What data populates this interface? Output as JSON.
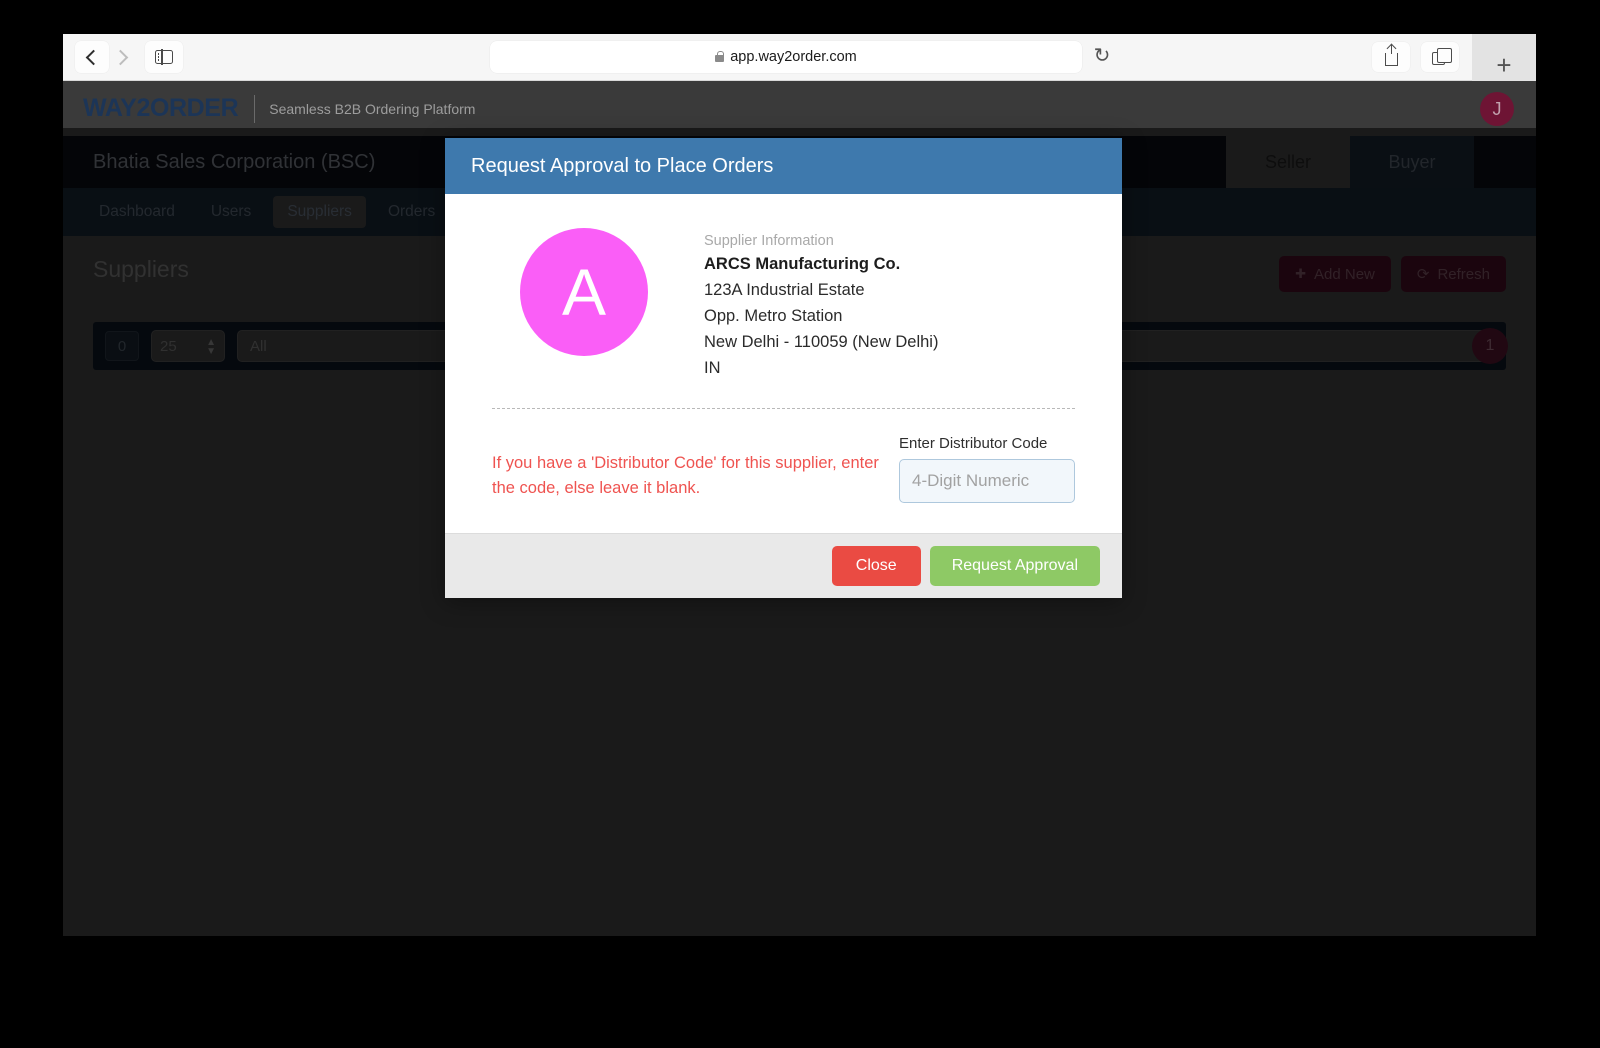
{
  "browser": {
    "url": "app.way2order.com",
    "back_icon": "chevron-left-icon",
    "forward_icon": "chevron-right-icon",
    "sidebar_icon": "sidebar-toggle-icon",
    "lock_icon": "lock-icon",
    "reload_icon": "↻",
    "share_icon": "share-icon",
    "tabs_icon": "tabs-overview-icon",
    "new_tab_label": "+"
  },
  "app_header": {
    "brand": "WAY2ORDER",
    "tagline": "Seamless B2B Ordering Platform",
    "avatar_initial": "J",
    "brand_color": "#1c3557",
    "avatar_color": "#6e1434"
  },
  "org_bar": {
    "org_name": "Bhatia Sales Corporation (BSC)",
    "role_tabs": [
      {
        "label": "Seller",
        "active": true
      },
      {
        "label": "Buyer",
        "active": false
      }
    ]
  },
  "nav": {
    "items": [
      {
        "label": "Dashboard",
        "active": false
      },
      {
        "label": "Users",
        "active": false
      },
      {
        "label": "Suppliers",
        "active": true
      },
      {
        "label": "Orders",
        "active": false
      }
    ]
  },
  "page": {
    "title": "Suppliers",
    "actions": [
      {
        "label": "Add New",
        "icon": "plus-icon",
        "glyph": "➕"
      },
      {
        "label": "Refresh",
        "icon": "refresh-icon",
        "glyph": "↻"
      }
    ],
    "toolbar": {
      "count": "0",
      "page_size": "25",
      "filter_value": "All"
    },
    "results_badge": "1",
    "accent_color": "#4a1228"
  },
  "dialog": {
    "title": "Request Approval to Place Orders",
    "header_color": "#3e79ad",
    "supplier": {
      "avatar_initial": "A",
      "avatar_color": "#fa5ef7",
      "section_label": "Supplier Information",
      "name": "ARCS Manufacturing Co.",
      "address_lines": [
        "123A Industrial Estate",
        "Opp. Metro Station",
        "New Delhi - 110059 (New Delhi)",
        "IN"
      ]
    },
    "code_section": {
      "help_text": "If you have a 'Distributor Code' for this supplier, enter the code, else leave it blank.",
      "help_color": "#ef5350",
      "label": "Enter Distributor Code",
      "placeholder": "4-Digit Numeric",
      "value": ""
    },
    "footer": {
      "close_label": "Close",
      "close_color": "#ea4b43",
      "approve_label": "Request Approval",
      "approve_color": "#8ec965"
    }
  }
}
